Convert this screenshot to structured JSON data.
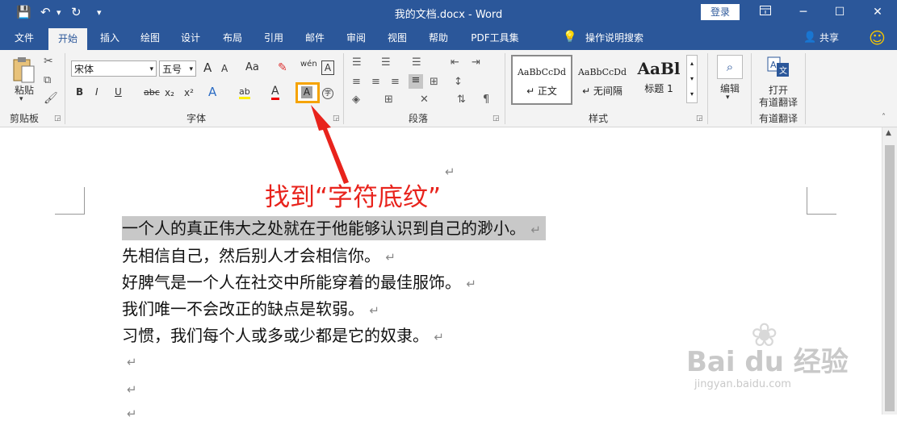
{
  "window": {
    "doc_title": "我的文档.docx  -  Word",
    "login_label": "登录",
    "restore_icon": "ribbon-display-icon",
    "minimize_symbol": "─",
    "maximize_symbol": "☐",
    "close_symbol": "✕"
  },
  "quick_access": {
    "save": "💾",
    "undo": "↶",
    "redo": "↻",
    "customize": "▾"
  },
  "tabs": [
    {
      "label": "文件"
    },
    {
      "label": "开始"
    },
    {
      "label": "插入"
    },
    {
      "label": "绘图"
    },
    {
      "label": "设计"
    },
    {
      "label": "布局"
    },
    {
      "label": "引用"
    },
    {
      "label": "邮件"
    },
    {
      "label": "审阅"
    },
    {
      "label": "视图"
    },
    {
      "label": "帮助"
    },
    {
      "label": "PDF工具集"
    }
  ],
  "tell_me": "操作说明搜索",
  "share": "共享",
  "smiley": "☺",
  "ribbon": {
    "clipboard": {
      "label": "剪贴板",
      "paste": "粘贴"
    },
    "font": {
      "label": "字体",
      "font_name": "宋体",
      "font_size": "五号",
      "grow": "A",
      "shrink": "A",
      "case": "Aa",
      "phonetic": "wén",
      "bold": "B",
      "italic": "I",
      "underline": "U",
      "strike": "abc",
      "sub": "x₂",
      "sup": "x²",
      "effects": "A",
      "highlight": "ab",
      "color": "A",
      "shading": "A",
      "enclose": "字",
      "border": "A"
    },
    "paragraph": {
      "label": "段落"
    },
    "styles": {
      "label": "样式",
      "items": [
        {
          "preview": "AaBbCcDd",
          "name": "↵ 正文"
        },
        {
          "preview": "AaBbCcDd",
          "name": "↵ 无间隔"
        },
        {
          "preview": "AaBl",
          "name": "标题 1"
        }
      ]
    },
    "editing": {
      "label": "编辑"
    },
    "youdao": {
      "line1": "打开",
      "line2": "有道翻译",
      "label": "有道翻译"
    }
  },
  "annotation": "找到“字符底纹”",
  "document": {
    "lines": [
      "一个人的真正伟大之处就在于他能够认识到自己的渺小。",
      "先相信自己，然后别人才会相信你。",
      "好脾气是一个人在社交中所能穿着的最佳服饰。",
      "我们唯一不会改正的缺点是软弱。",
      "习惯，我们每个人或多或少都是它的奴隶。"
    ],
    "para_mark": "↵"
  },
  "watermark": {
    "brand": "Bai du 经验",
    "url": "jingyan.baidu.com"
  },
  "colors": {
    "title_bar": "#2b579a",
    "highlight_box": "#f5a300",
    "annotation": "#e8231c",
    "selection": "#c8c8c8"
  }
}
